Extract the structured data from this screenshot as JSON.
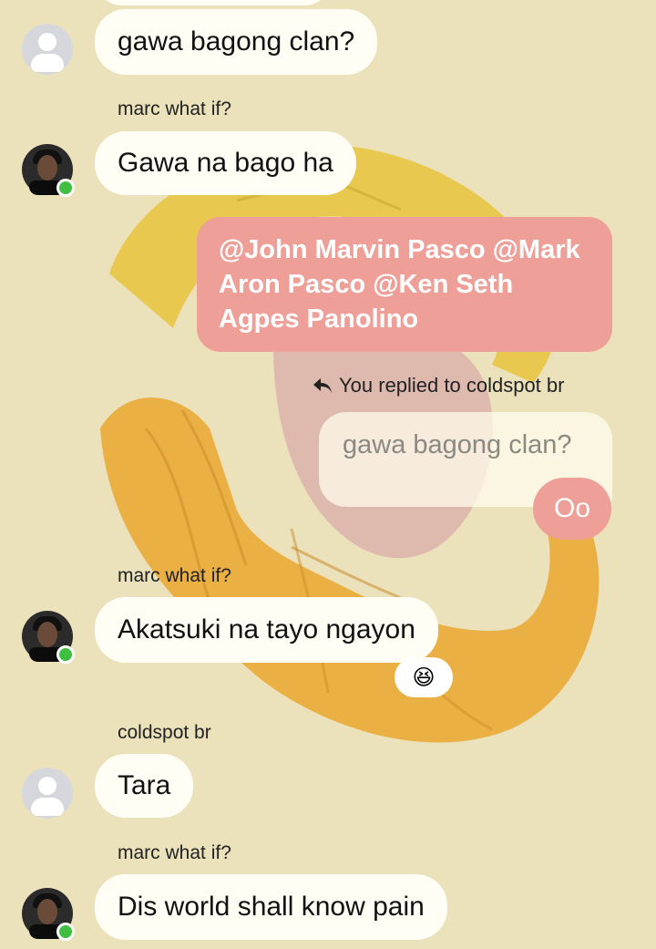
{
  "messages": [
    {
      "avatar": "default-avatar-icon",
      "text": "gawa bagong clan?"
    },
    {
      "sender": "marc what if?",
      "avatar": "profile-photo",
      "online": true,
      "text": "Gawa na bago ha"
    },
    {
      "mine": true,
      "text": "@John Marvin Pasco @Mark Aron Pasco @Ken Seth Agpes Panolino"
    },
    {
      "mine": true,
      "reply_note": "You replied to coldspot br",
      "reply_icon": "reply-arrow-icon",
      "quoted": "gawa bagong clan?",
      "text": "Oo"
    },
    {
      "sender": "marc what if?",
      "avatar": "profile-photo",
      "online": true,
      "text": "Akatsuki na tayo ngayon",
      "reaction": "😆"
    },
    {
      "sender": "coldspot br",
      "avatar": "default-avatar-icon",
      "text": "Tara"
    },
    {
      "sender": "marc what if?",
      "avatar": "profile-photo",
      "online": true,
      "text": "Dis world shall know pain"
    }
  ],
  "colors": {
    "background": "#ebe1bb",
    "my_bubble": "#ee9f98",
    "their_bubble": "#fffdf4",
    "online": "#3fbf3f"
  }
}
